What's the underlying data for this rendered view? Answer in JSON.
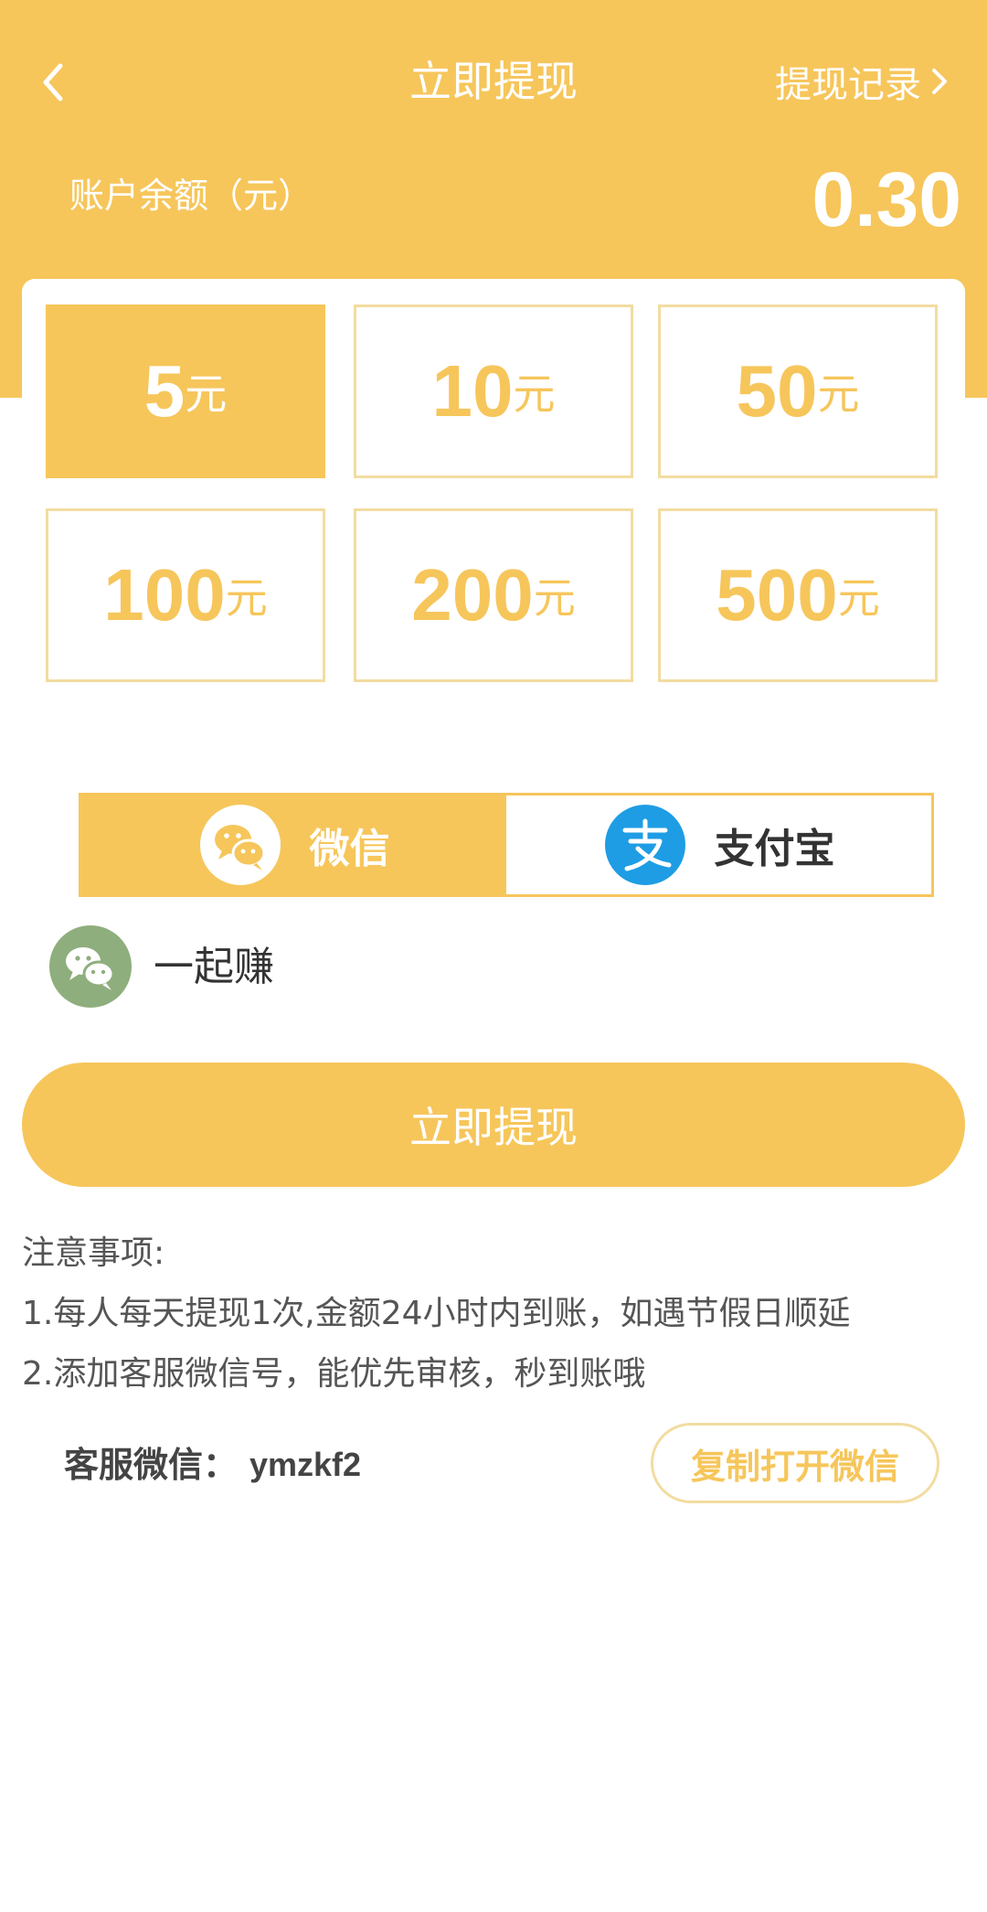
{
  "header": {
    "title": "立即提现",
    "records_label": "提现记录",
    "balance_label": "账户余额（元）",
    "balance_value": "0.30"
  },
  "amounts": [
    {
      "value": "5",
      "unit": "元",
      "selected": true
    },
    {
      "value": "10",
      "unit": "元",
      "selected": false
    },
    {
      "value": "50",
      "unit": "元",
      "selected": false
    },
    {
      "value": "100",
      "unit": "元",
      "selected": false
    },
    {
      "value": "200",
      "unit": "元",
      "selected": false
    },
    {
      "value": "500",
      "unit": "元",
      "selected": false
    }
  ],
  "payment_methods": [
    {
      "label": "微信",
      "icon": "wechat-icon",
      "selected": true
    },
    {
      "label": "支付宝",
      "icon": "alipay-icon",
      "selected": false
    }
  ],
  "account": {
    "name": "一起赚",
    "icon": "wechat-avatar-icon"
  },
  "withdraw_button": "立即提现",
  "notes": {
    "title": "注意事项:",
    "items": [
      "1.每人每天提现1次,金额24小时内到账，如遇节假日顺延",
      "2.添加客服微信号，能优先审核，秒到账哦"
    ]
  },
  "service": {
    "label": "客服微信：",
    "id": "ymzkf2",
    "copy_button": "复制打开微信"
  },
  "colors": {
    "accent": "#F6C65B",
    "border": "#F2DCA0",
    "alipay": "#1E9DE4",
    "avatar": "#8FAE7D"
  }
}
